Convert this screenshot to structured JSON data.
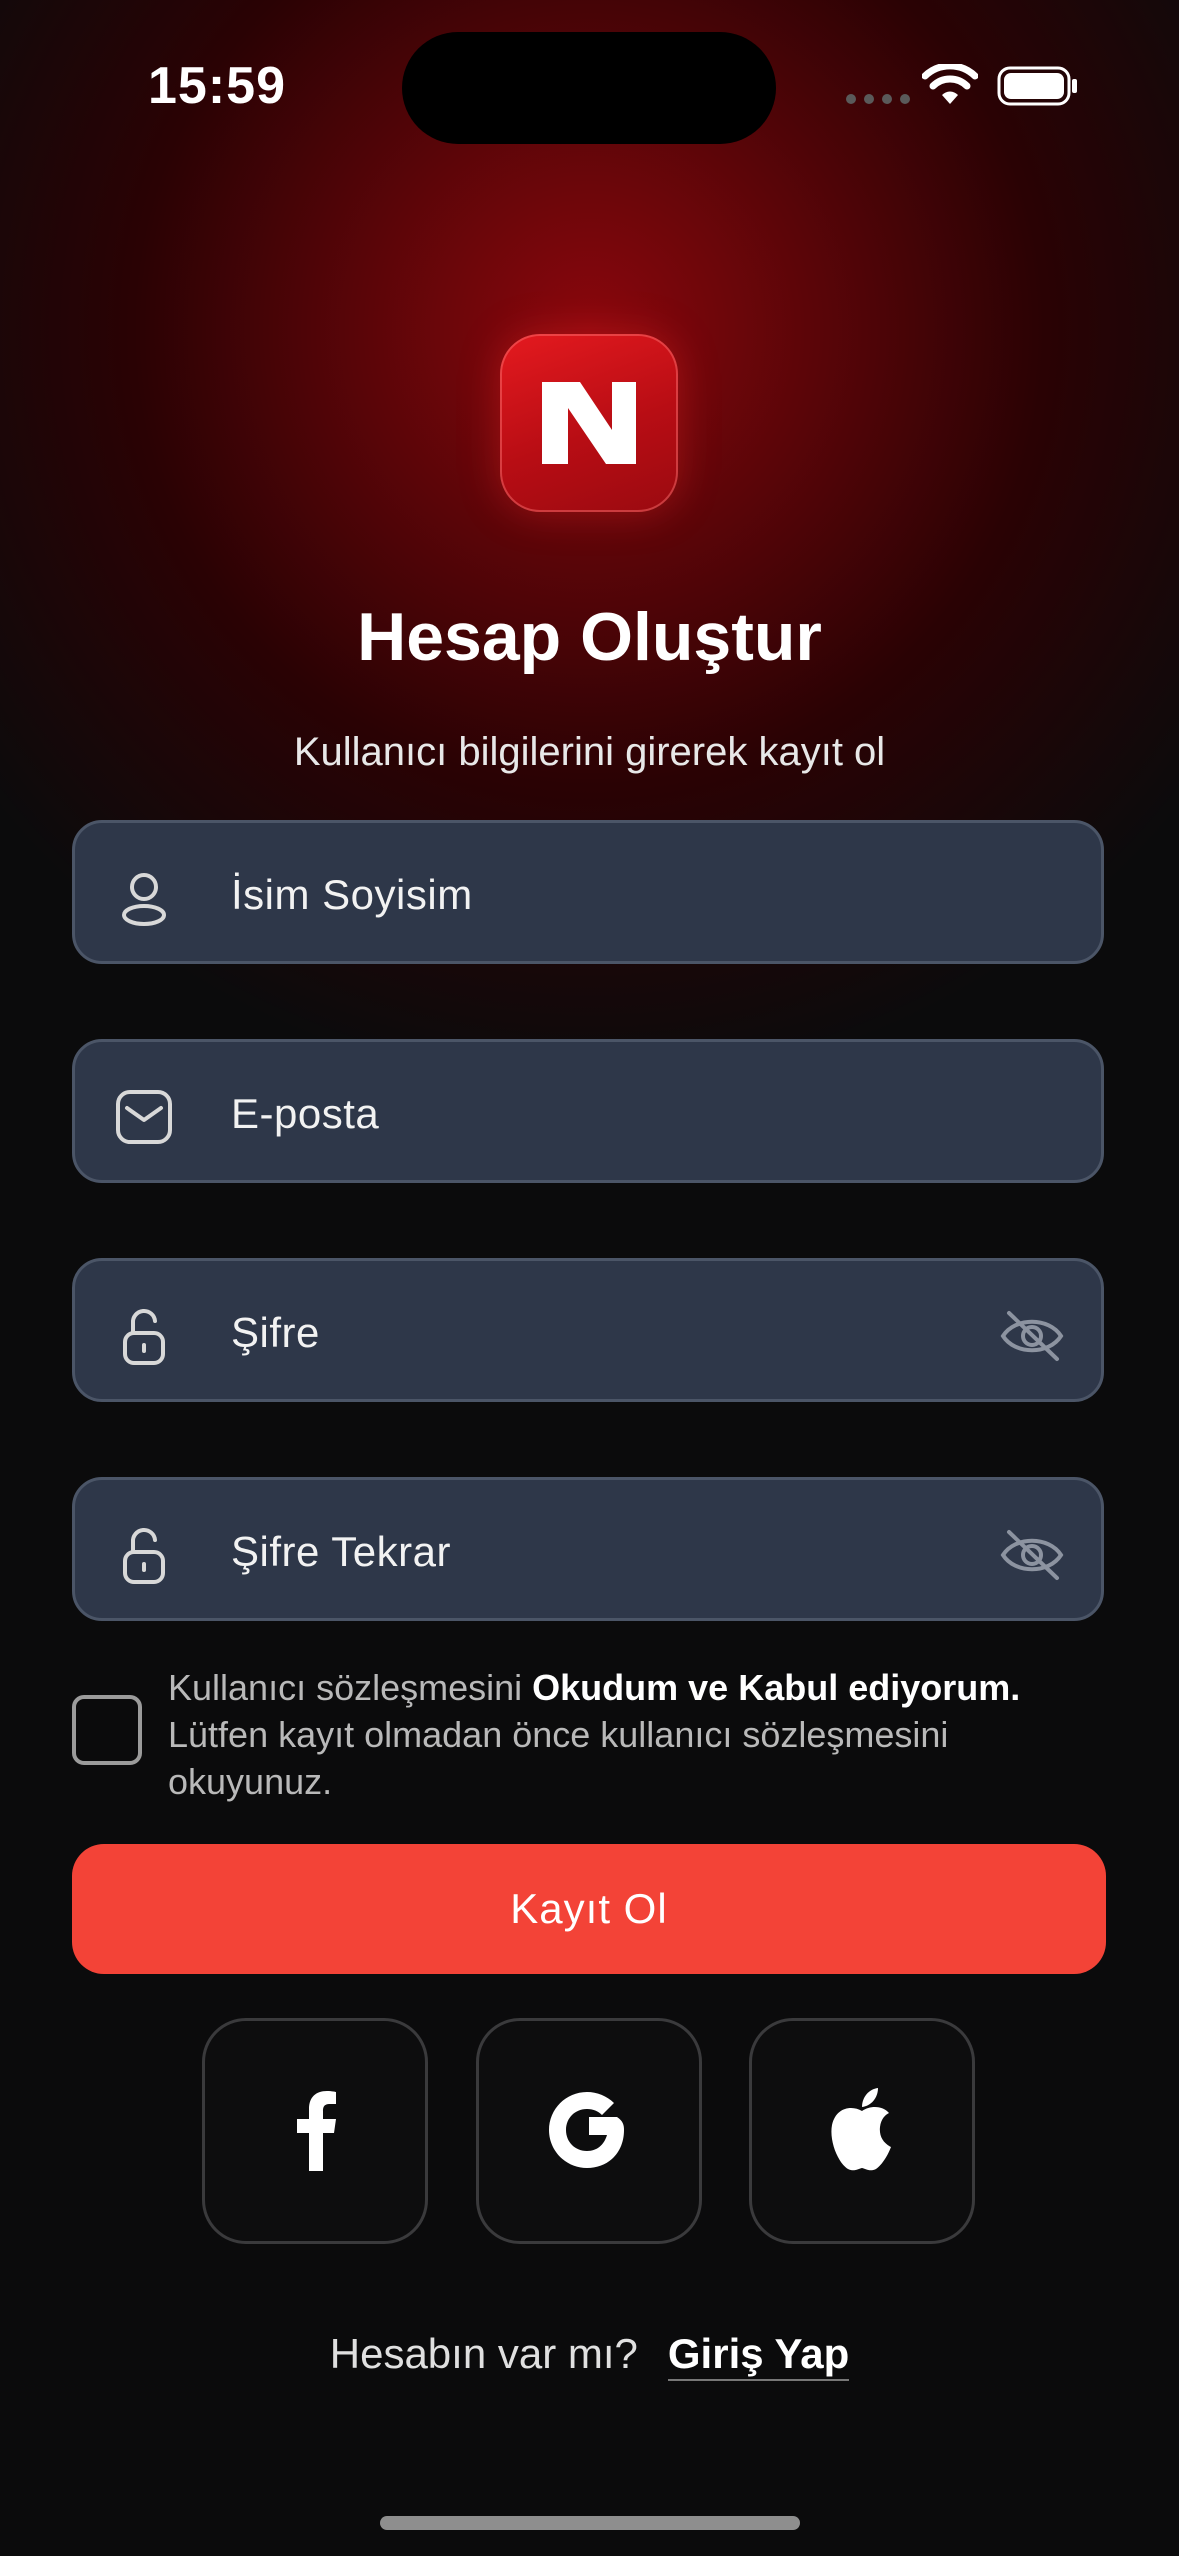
{
  "status_bar": {
    "time": "15:59"
  },
  "header": {
    "title": "Hesap Oluştur",
    "subtitle": "Kullanıcı bilgilerini girerek kayıt ol"
  },
  "form": {
    "name_placeholder": "İsim Soyisim",
    "email_placeholder": "E-posta",
    "password_placeholder": "Şifre",
    "password_repeat_placeholder": "Şifre Tekrar",
    "terms_prefix": "Kullanıcı sözleşmesini ",
    "terms_link": "Okudum ve Kabul ediyorum.",
    "terms_note": "Lütfen kayıt olmadan önce kullanıcı sözleşmesini okuyunuz.",
    "terms_checked": false,
    "submit_label": "Kayıt Ol"
  },
  "social": [
    "facebook",
    "google",
    "apple"
  ],
  "footer": {
    "question": "Hesabın var mı?",
    "login_link": "Giriş Yap"
  },
  "colors": {
    "accent": "#f34337",
    "field_bg": "#2e3749",
    "background": "#0b0b0c",
    "logo_red": "#d4121a"
  }
}
